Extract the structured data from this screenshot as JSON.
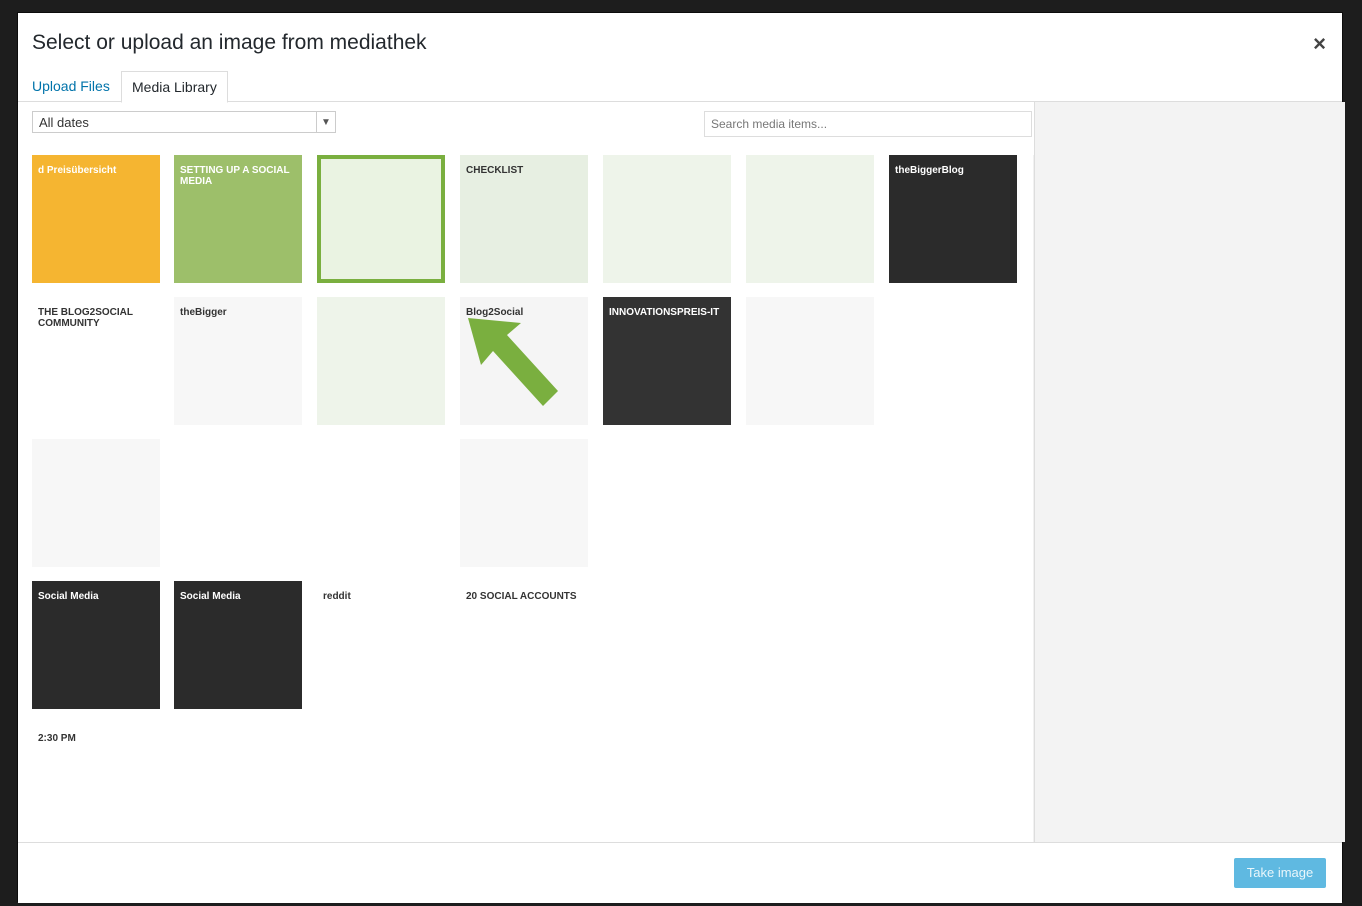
{
  "dialog": {
    "title": "Select or upload an image from mediathek",
    "close_label": "×"
  },
  "tabs": [
    {
      "label": "Upload Files"
    },
    {
      "label": "Media Library"
    }
  ],
  "filters": {
    "date_select": "All dates",
    "search_placeholder": "Search media items..."
  },
  "grid": {
    "thumb_labels": [
      "d Preisübersicht",
      "SETTING UP A SOCIAL MEDIA",
      "",
      "CHECKLIST",
      "",
      "",
      "theBiggerBlog",
      "THE BLOG2SOCIAL COMMUNITY",
      "theBigger",
      "",
      "Blog2Social",
      "INNOVATIONSPREIS-IT",
      "",
      "",
      "",
      "",
      "",
      "",
      "",
      "",
      "",
      "Social Media",
      "Social Media",
      "reddit",
      "20 SOCIAL ACCOUNTS",
      "",
      "",
      "",
      "2:30 PM",
      "",
      "",
      "",
      "",
      "",
      ""
    ]
  },
  "footer": {
    "take_image_label": "Take image"
  }
}
